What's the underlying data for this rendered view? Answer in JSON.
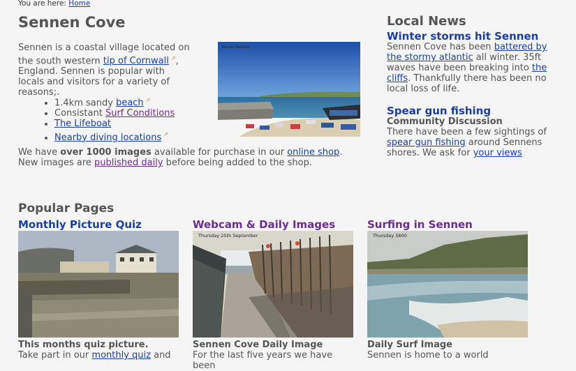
{
  "breadcrumb": {
    "prefix": "You are here:",
    "home": "Home"
  },
  "page_title": "Sennen Cove",
  "intro": {
    "t1": "Sennen is a coastal village located on the south western ",
    "link1": "tip of Cornwall",
    "t2": ", England. Sennen is popular with locals and visitors for a variety of reasons;."
  },
  "bullets": [
    {
      "pre": "1.4km sandy ",
      "link": "beach"
    },
    {
      "pre": "Consistant ",
      "link": "Surf Conditions"
    },
    {
      "pre": "",
      "link": "The Lifeboat"
    },
    {
      "pre": "",
      "link": "Nearby diving locations"
    }
  ],
  "shop": {
    "t1": "We have ",
    "bold": "over 1000 images",
    "t2": " available for purchase in our ",
    "link1": "online shop",
    "t3": ". New images are ",
    "link2": "published daily",
    "t4": " before being added to the shop."
  },
  "hero_caption": "Sennen Harbour",
  "news": {
    "title": "Local News",
    "items": [
      {
        "headline": "Winter storms hit Sennen",
        "t1": "Sennen Cove has been ",
        "link1": "battered by the stormy atlantic",
        "t2": " all winter. 35ft waves have been breaking into ",
        "link2": "the cliffs",
        "t3": ". Thankfully there has been no local loss of life."
      },
      {
        "headline": "Spear gun fishing",
        "subhead": "Community Discussion",
        "t1": "There have been a few sightings of ",
        "link1": "spear gun fishing",
        "t2": " around Sennens shores. We ask for ",
        "link2": "your views"
      }
    ]
  },
  "popular": {
    "title": "Popular Pages",
    "cards": [
      {
        "title": "Monthly Picture Quiz",
        "caption": "",
        "subtitle": "This months quiz picture.",
        "t1": "Take part in our ",
        "link": "monthly quiz",
        "t2": " and"
      },
      {
        "title": "Webcam & Daily Images",
        "caption": "Thursday 25th September",
        "subtitle": "Sennen Cove Daily Image",
        "t1": "For the last five years we have been",
        "link": "",
        "t2": ""
      },
      {
        "title": "Surfing in Sennen",
        "caption": "Thursday 1600",
        "subtitle": "Daily Surf Image",
        "t1": "Sennen is home to a world",
        "link": "",
        "t2": ""
      }
    ]
  }
}
